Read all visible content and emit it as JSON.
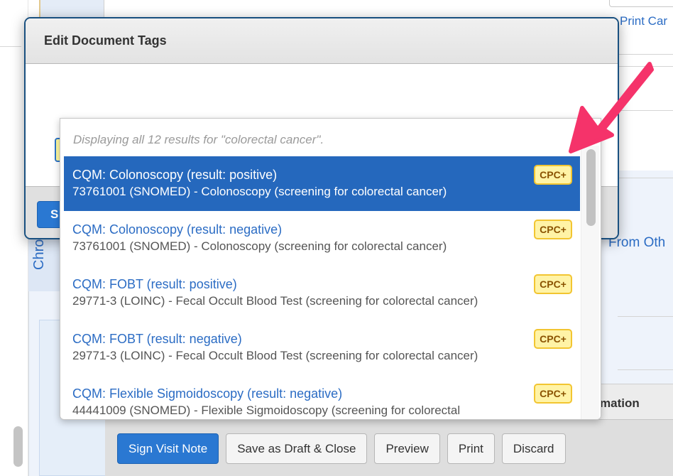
{
  "background": {
    "chron_label": "Chron",
    "print_card_link": "Print Car",
    "from_other_link": "From Oth",
    "info_label": "mation",
    "footer_buttons": {
      "sign": "Sign Visit Note",
      "save_draft": "Save as Draft & Close",
      "preview": "Preview",
      "print": "Print",
      "discard": "Discard"
    }
  },
  "modal": {
    "title": "Edit Document Tags",
    "search_value": "colorectal cancer",
    "save_button_partial": "S",
    "dropdown": {
      "status": "Displaying all 12 results for \"colorectal cancer\".",
      "results": [
        {
          "title": "CQM: Colonoscopy (result: positive)",
          "description": "73761001 (SNOMED) - Colonoscopy (screening for colorectal cancer)",
          "badge": "CPC+",
          "selected": true
        },
        {
          "title": "CQM: Colonoscopy (result: negative)",
          "description": "73761001 (SNOMED) - Colonoscopy (screening for colorectal cancer)",
          "badge": "CPC+",
          "selected": false
        },
        {
          "title": "CQM: FOBT (result: positive)",
          "description": "29771-3 (LOINC) - Fecal Occult Blood Test (screening for colorectal cancer)",
          "badge": "CPC+",
          "selected": false
        },
        {
          "title": "CQM: FOBT (result: negative)",
          "description": "29771-3 (LOINC) - Fecal Occult Blood Test (screening for colorectal cancer)",
          "badge": "CPC+",
          "selected": false
        },
        {
          "title": "CQM: Flexible Sigmoidoscopy (result: negative)",
          "description": "44441009 (SNOMED) - Flexible Sigmoidoscopy (screening for colorectal",
          "badge": "CPC+",
          "selected": false
        }
      ]
    }
  },
  "colors": {
    "accent_blue": "#2a78d2",
    "selected_row": "#2568bd",
    "link_blue": "#2b6cc4",
    "input_highlight": "#fffaa0",
    "badge_bg": "#fff3a6",
    "badge_border": "#f2c531",
    "annotation_arrow": "#f5336a"
  }
}
